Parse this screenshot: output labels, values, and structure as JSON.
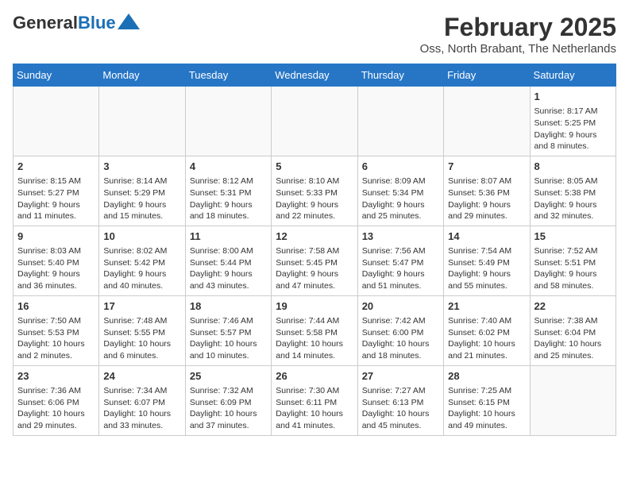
{
  "header": {
    "logo_general": "General",
    "logo_blue": "Blue",
    "month": "February 2025",
    "location": "Oss, North Brabant, The Netherlands"
  },
  "days_of_week": [
    "Sunday",
    "Monday",
    "Tuesday",
    "Wednesday",
    "Thursday",
    "Friday",
    "Saturday"
  ],
  "weeks": [
    [
      {
        "day": "",
        "detail": ""
      },
      {
        "day": "",
        "detail": ""
      },
      {
        "day": "",
        "detail": ""
      },
      {
        "day": "",
        "detail": ""
      },
      {
        "day": "",
        "detail": ""
      },
      {
        "day": "",
        "detail": ""
      },
      {
        "day": "1",
        "detail": "Sunrise: 8:17 AM\nSunset: 5:25 PM\nDaylight: 9 hours and 8 minutes."
      }
    ],
    [
      {
        "day": "2",
        "detail": "Sunrise: 8:15 AM\nSunset: 5:27 PM\nDaylight: 9 hours and 11 minutes."
      },
      {
        "day": "3",
        "detail": "Sunrise: 8:14 AM\nSunset: 5:29 PM\nDaylight: 9 hours and 15 minutes."
      },
      {
        "day": "4",
        "detail": "Sunrise: 8:12 AM\nSunset: 5:31 PM\nDaylight: 9 hours and 18 minutes."
      },
      {
        "day": "5",
        "detail": "Sunrise: 8:10 AM\nSunset: 5:33 PM\nDaylight: 9 hours and 22 minutes."
      },
      {
        "day": "6",
        "detail": "Sunrise: 8:09 AM\nSunset: 5:34 PM\nDaylight: 9 hours and 25 minutes."
      },
      {
        "day": "7",
        "detail": "Sunrise: 8:07 AM\nSunset: 5:36 PM\nDaylight: 9 hours and 29 minutes."
      },
      {
        "day": "8",
        "detail": "Sunrise: 8:05 AM\nSunset: 5:38 PM\nDaylight: 9 hours and 32 minutes."
      }
    ],
    [
      {
        "day": "9",
        "detail": "Sunrise: 8:03 AM\nSunset: 5:40 PM\nDaylight: 9 hours and 36 minutes."
      },
      {
        "day": "10",
        "detail": "Sunrise: 8:02 AM\nSunset: 5:42 PM\nDaylight: 9 hours and 40 minutes."
      },
      {
        "day": "11",
        "detail": "Sunrise: 8:00 AM\nSunset: 5:44 PM\nDaylight: 9 hours and 43 minutes."
      },
      {
        "day": "12",
        "detail": "Sunrise: 7:58 AM\nSunset: 5:45 PM\nDaylight: 9 hours and 47 minutes."
      },
      {
        "day": "13",
        "detail": "Sunrise: 7:56 AM\nSunset: 5:47 PM\nDaylight: 9 hours and 51 minutes."
      },
      {
        "day": "14",
        "detail": "Sunrise: 7:54 AM\nSunset: 5:49 PM\nDaylight: 9 hours and 55 minutes."
      },
      {
        "day": "15",
        "detail": "Sunrise: 7:52 AM\nSunset: 5:51 PM\nDaylight: 9 hours and 58 minutes."
      }
    ],
    [
      {
        "day": "16",
        "detail": "Sunrise: 7:50 AM\nSunset: 5:53 PM\nDaylight: 10 hours and 2 minutes."
      },
      {
        "day": "17",
        "detail": "Sunrise: 7:48 AM\nSunset: 5:55 PM\nDaylight: 10 hours and 6 minutes."
      },
      {
        "day": "18",
        "detail": "Sunrise: 7:46 AM\nSunset: 5:57 PM\nDaylight: 10 hours and 10 minutes."
      },
      {
        "day": "19",
        "detail": "Sunrise: 7:44 AM\nSunset: 5:58 PM\nDaylight: 10 hours and 14 minutes."
      },
      {
        "day": "20",
        "detail": "Sunrise: 7:42 AM\nSunset: 6:00 PM\nDaylight: 10 hours and 18 minutes."
      },
      {
        "day": "21",
        "detail": "Sunrise: 7:40 AM\nSunset: 6:02 PM\nDaylight: 10 hours and 21 minutes."
      },
      {
        "day": "22",
        "detail": "Sunrise: 7:38 AM\nSunset: 6:04 PM\nDaylight: 10 hours and 25 minutes."
      }
    ],
    [
      {
        "day": "23",
        "detail": "Sunrise: 7:36 AM\nSunset: 6:06 PM\nDaylight: 10 hours and 29 minutes."
      },
      {
        "day": "24",
        "detail": "Sunrise: 7:34 AM\nSunset: 6:07 PM\nDaylight: 10 hours and 33 minutes."
      },
      {
        "day": "25",
        "detail": "Sunrise: 7:32 AM\nSunset: 6:09 PM\nDaylight: 10 hours and 37 minutes."
      },
      {
        "day": "26",
        "detail": "Sunrise: 7:30 AM\nSunset: 6:11 PM\nDaylight: 10 hours and 41 minutes."
      },
      {
        "day": "27",
        "detail": "Sunrise: 7:27 AM\nSunset: 6:13 PM\nDaylight: 10 hours and 45 minutes."
      },
      {
        "day": "28",
        "detail": "Sunrise: 7:25 AM\nSunset: 6:15 PM\nDaylight: 10 hours and 49 minutes."
      },
      {
        "day": "",
        "detail": ""
      }
    ]
  ]
}
